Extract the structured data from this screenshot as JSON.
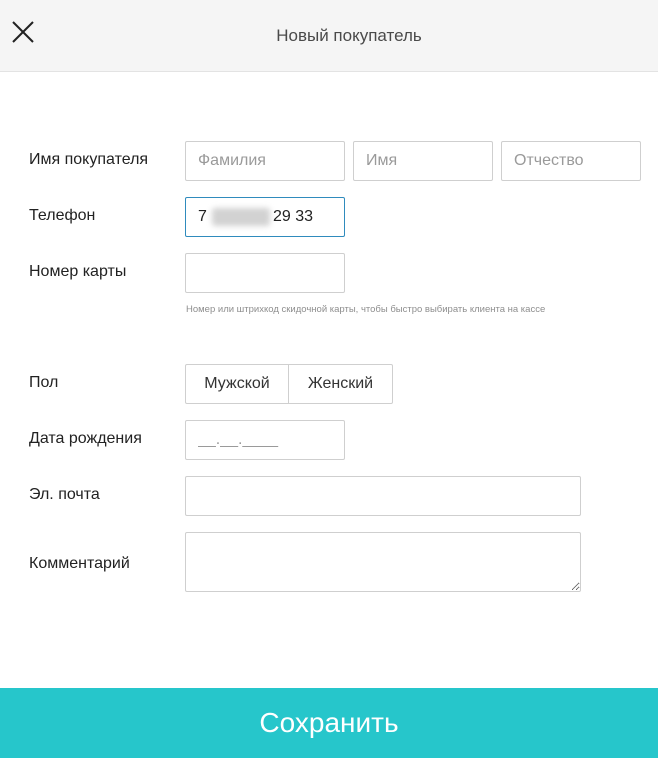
{
  "header": {
    "title": "Новый покупатель",
    "close_icon": "close-icon"
  },
  "form": {
    "name": {
      "label": "Имя покупателя",
      "last_name_placeholder": "Фамилия",
      "first_name_placeholder": "Имя",
      "middle_name_placeholder": "Отчество"
    },
    "phone": {
      "label": "Телефон",
      "value_prefix": "7",
      "value_suffix": "29 33"
    },
    "card": {
      "label": "Номер карты",
      "value": "",
      "hint": "Номер или штрихкод скидочной карты, чтобы быстро выбирать клиента на кассе"
    },
    "gender": {
      "label": "Пол",
      "options": [
        "Мужской",
        "Женский"
      ]
    },
    "birthdate": {
      "label": "Дата рождения",
      "mask": "__.__.____"
    },
    "email": {
      "label": "Эл. почта",
      "value": ""
    },
    "comment": {
      "label": "Комментарий",
      "value": ""
    }
  },
  "footer": {
    "save_label": "Сохранить"
  },
  "colors": {
    "accent": "#26c6cb",
    "focus_border": "#2f8bbd",
    "header_bg": "#f5f5f5"
  }
}
